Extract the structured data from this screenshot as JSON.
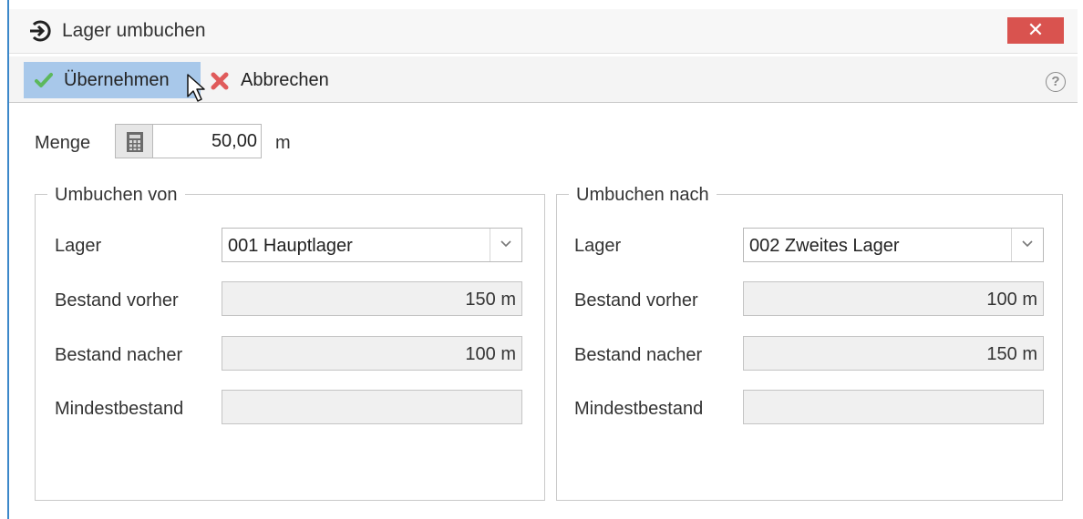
{
  "window": {
    "title": "Lager umbuchen",
    "close_label": "✕"
  },
  "toolbar": {
    "accept_label": "Übernehmen",
    "cancel_label": "Abbrechen",
    "help_label": "?"
  },
  "menge": {
    "label": "Menge",
    "value": "50,00",
    "unit": "m"
  },
  "from": {
    "legend": "Umbuchen von",
    "lager_label": "Lager",
    "lager_value": "001 Hauptlager",
    "bestand_vorher_label": "Bestand vorher",
    "bestand_vorher_value": "150 m",
    "bestand_nacher_label": "Bestand nacher",
    "bestand_nacher_value": "100 m",
    "mindestbestand_label": "Mindestbestand",
    "mindestbestand_value": ""
  },
  "to": {
    "legend": "Umbuchen nach",
    "lager_label": "Lager",
    "lager_value": "002 Zweites Lager",
    "bestand_vorher_label": "Bestand vorher",
    "bestand_vorher_value": "100 m",
    "bestand_nacher_label": "Bestand nacher",
    "bestand_nacher_value": "150 m",
    "mindestbestand_label": "Mindestbestand",
    "mindestbestand_value": ""
  },
  "colors": {
    "accent": "#3c88c9",
    "close": "#d9534f",
    "selected_button": "#a8c8ea",
    "check": "#5cb85c",
    "cancel_x": "#e05b5b"
  },
  "icons": {
    "app": "transfer-arrow-icon",
    "accept": "check-icon",
    "cancel": "cross-icon",
    "help": "help-icon",
    "calculator": "calculator-icon",
    "dropdown": "chevron-down-icon"
  }
}
